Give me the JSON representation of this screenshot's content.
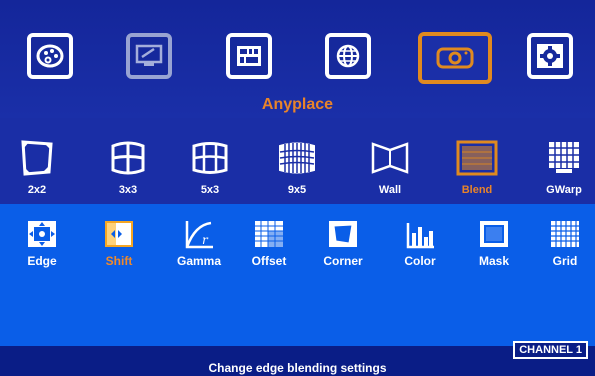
{
  "mode_title": "Anyplace",
  "top_menu": [
    {
      "icon": "palette-icon"
    },
    {
      "icon": "monitor-settings-icon"
    },
    {
      "icon": "layout-icon"
    },
    {
      "icon": "globe-icon"
    },
    {
      "icon": "projector-icon"
    },
    {
      "icon": "gear-icon"
    }
  ],
  "modes": [
    {
      "label": "2x2"
    },
    {
      "label": "3x3"
    },
    {
      "label": "5x3"
    },
    {
      "label": "9x5"
    },
    {
      "label": "Wall"
    },
    {
      "label": "Blend"
    },
    {
      "label": "GWarp"
    }
  ],
  "sub_items": [
    {
      "label": "Edge"
    },
    {
      "label": "Shift"
    },
    {
      "label": "Gamma"
    },
    {
      "label": "Offset"
    },
    {
      "label": "Corner"
    },
    {
      "label": "Color"
    },
    {
      "label": "Mask"
    },
    {
      "label": "Grid"
    }
  ],
  "status": {
    "help": "Change edge blending settings",
    "channel": "CHANNEL 1"
  },
  "colors": {
    "accent": "#e8842a",
    "panel": "#0a5ee8",
    "background": "#15289a"
  }
}
